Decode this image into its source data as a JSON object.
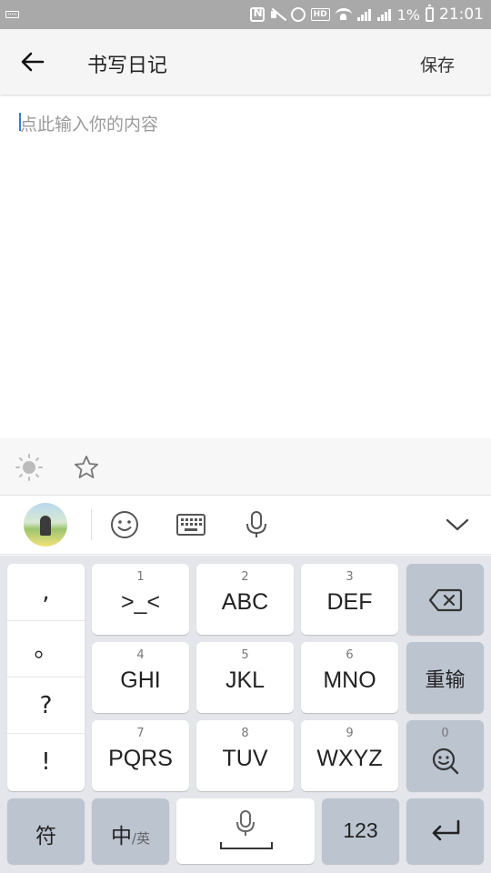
{
  "status_bar": {
    "battery": "1%",
    "time": "21:01",
    "icons": [
      "keyboard-mini-icon",
      "nfc-icon",
      "mute-icon",
      "alarm-icon",
      "hd-icon",
      "wifi-icon",
      "signal-4g-icon",
      "signal-e-icon",
      "battery-icon"
    ]
  },
  "app_bar": {
    "title": "书写日记",
    "save_label": "保存",
    "back_icon": "arrow-left-icon"
  },
  "editor": {
    "placeholder": "点此输入你的内容",
    "value": ""
  },
  "attr_toolbar": {
    "icons": [
      "weather-sun-icon",
      "star-outline-icon"
    ]
  },
  "keyboard_toolbar": {
    "icons": [
      "avatar",
      "emoji-icon",
      "keyboard-icon",
      "microphone-icon",
      "chevron-down-icon"
    ]
  },
  "keyboard": {
    "punctuation": [
      ",",
      "。",
      "?",
      "!"
    ],
    "rows": [
      [
        {
          "num": "1",
          "label": ">_<"
        },
        {
          "num": "2",
          "label": "ABC"
        },
        {
          "num": "3",
          "label": "DEF"
        }
      ],
      [
        {
          "num": "4",
          "label": "GHI"
        },
        {
          "num": "5",
          "label": "JKL"
        },
        {
          "num": "6",
          "label": "MNO"
        }
      ],
      [
        {
          "num": "7",
          "label": "PQRS"
        },
        {
          "num": "8",
          "label": "TUV"
        },
        {
          "num": "9",
          "label": "WXYZ"
        }
      ]
    ],
    "retype_label": "重输",
    "zero_num": "0",
    "symbols_label": "符",
    "lang_main": "中",
    "lang_alt": "/英",
    "numbers_label": "123",
    "colors": {
      "key": "#ffffff",
      "function_key": "#bcc4d0",
      "background": "#e4e6eb"
    }
  }
}
